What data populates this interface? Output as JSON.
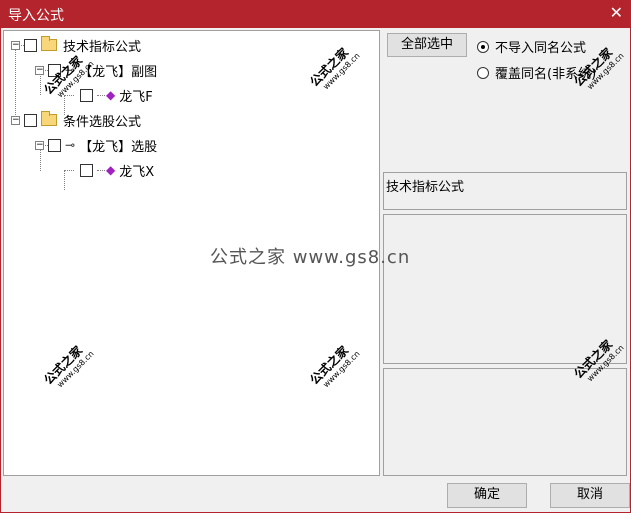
{
  "window": {
    "title": "导入公式",
    "close_glyph": "✕"
  },
  "tree": {
    "nodes": [
      {
        "label": "技术指标公式",
        "expander": "−"
      },
      {
        "label": "【龙飞】副图",
        "expander": "−"
      },
      {
        "label": "龙飞F"
      },
      {
        "label": "条件选股公式",
        "expander": "−"
      },
      {
        "label": "【龙飞】选股",
        "expander": "−"
      },
      {
        "label": "龙飞X"
      }
    ]
  },
  "buttons": {
    "select_all": "全部选中",
    "ok": "确定",
    "cancel": "取消"
  },
  "options": [
    {
      "label": "不导入同名公式",
      "checked": true
    },
    {
      "label": "覆盖同名(非系统)",
      "checked": false
    }
  ],
  "info": {
    "category": "技术指标公式"
  },
  "watermark": {
    "site": "公式之家",
    "url": "www.gs8.cn",
    "center_text": "公式之家 www.gs8.cn"
  },
  "colors": {
    "title_bar": "#b3242c",
    "folder": "#f7d77a",
    "gem": "#a020c0"
  }
}
